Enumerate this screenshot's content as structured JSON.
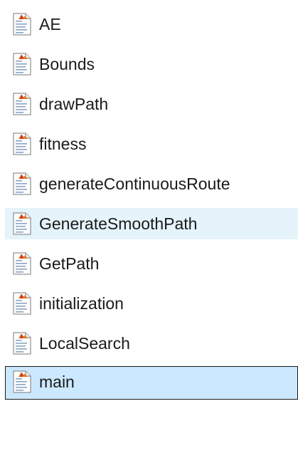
{
  "files": [
    {
      "name": "AE",
      "icon": "matlab-file-icon",
      "state": "normal"
    },
    {
      "name": "Bounds",
      "icon": "matlab-file-icon",
      "state": "normal"
    },
    {
      "name": "drawPath",
      "icon": "matlab-file-icon",
      "state": "normal"
    },
    {
      "name": "fitness",
      "icon": "matlab-file-icon",
      "state": "normal"
    },
    {
      "name": "generateContinuousRoute",
      "icon": "matlab-file-icon",
      "state": "normal"
    },
    {
      "name": "GenerateSmoothPath",
      "icon": "matlab-file-icon",
      "state": "hover"
    },
    {
      "name": "GetPath",
      "icon": "matlab-file-icon",
      "state": "normal"
    },
    {
      "name": "initialization",
      "icon": "matlab-file-icon",
      "state": "normal"
    },
    {
      "name": "LocalSearch",
      "icon": "matlab-file-icon",
      "state": "normal"
    },
    {
      "name": "main",
      "icon": "matlab-file-icon",
      "state": "selected"
    }
  ],
  "colors": {
    "hover_bg": "#e5f3fb",
    "selected_bg": "#cce8ff",
    "text": "#1a1a1a"
  }
}
